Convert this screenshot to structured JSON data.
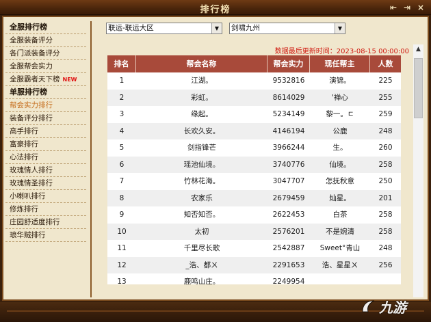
{
  "window": {
    "title": "排行榜",
    "buttons": [
      "⇤",
      "⇥",
      "×"
    ]
  },
  "sidebar": {
    "items": [
      {
        "label": "全服排行榜",
        "type": "head"
      },
      {
        "label": "全服装备评分",
        "type": "item"
      },
      {
        "label": "各门派装备评分",
        "type": "item"
      },
      {
        "label": "全服帮会实力",
        "type": "item"
      },
      {
        "label": "全服霸者天下榜",
        "type": "item",
        "badge": "NEW"
      },
      {
        "label": "单服排行榜",
        "type": "head"
      },
      {
        "label": "帮会实力排行",
        "type": "item",
        "active": true
      },
      {
        "label": "装备评分排行",
        "type": "item"
      },
      {
        "label": "高手排行",
        "type": "item"
      },
      {
        "label": "富豪排行",
        "type": "item"
      },
      {
        "label": "心法排行",
        "type": "item"
      },
      {
        "label": "玫瑰情人排行",
        "type": "item"
      },
      {
        "label": "玫瑰情圣排行",
        "type": "item"
      },
      {
        "label": "小喇叭排行",
        "type": "item"
      },
      {
        "label": "修炼排行",
        "type": "item"
      },
      {
        "label": "庄园舒适度排行",
        "type": "item"
      },
      {
        "label": "琅华贼排行",
        "type": "item"
      }
    ]
  },
  "filters": {
    "region": "联运-联运大区",
    "server": "剑啸九州"
  },
  "update_time": "数据最后更新时间：2023-08-15 00:00:00",
  "table": {
    "columns": [
      "排名",
      "帮会名称",
      "帮会实力",
      "现任帮主",
      "人数"
    ],
    "rows": [
      [
        "1",
        "江湖。",
        "9532816",
        "演锦。",
        "225"
      ],
      [
        "2",
        "彩虹。",
        "8614029",
        "'禅心",
        "255"
      ],
      [
        "3",
        "缘起。",
        "5234149",
        "黎一。ㄷ",
        "259"
      ],
      [
        "4",
        "长欢久安。",
        "4146194",
        "公鹿",
        "248"
      ],
      [
        "5",
        "剑指锋芒",
        "3966244",
        "生。",
        "260"
      ],
      [
        "6",
        "瑶池仙境。",
        "3740776",
        "仙境。",
        "258"
      ],
      [
        "7",
        "竹林花海。",
        "3047707",
        "怎抚秋意",
        "250"
      ],
      [
        "8",
        "农家乐",
        "2679459",
        "灿星。",
        "201"
      ],
      [
        "9",
        "知否知否。",
        "2622453",
        "白茶",
        "258"
      ],
      [
        "10",
        "太初",
        "2576201",
        "不是婉清",
        "258"
      ],
      [
        "11",
        "千里尽长歌",
        "2542887",
        "Sweet°青山",
        "248"
      ],
      [
        "12",
        "_浩、都ㄨ",
        "2291653",
        "浩、星星ㄨ",
        "256"
      ],
      [
        "13",
        "鹿鸣山庄。",
        "2249954",
        "",
        ""
      ]
    ]
  },
  "watermark": {
    "text": "九游"
  },
  "colors": {
    "header": "#a84a3a",
    "accent": "#c46a18",
    "update": "#d01a10"
  }
}
